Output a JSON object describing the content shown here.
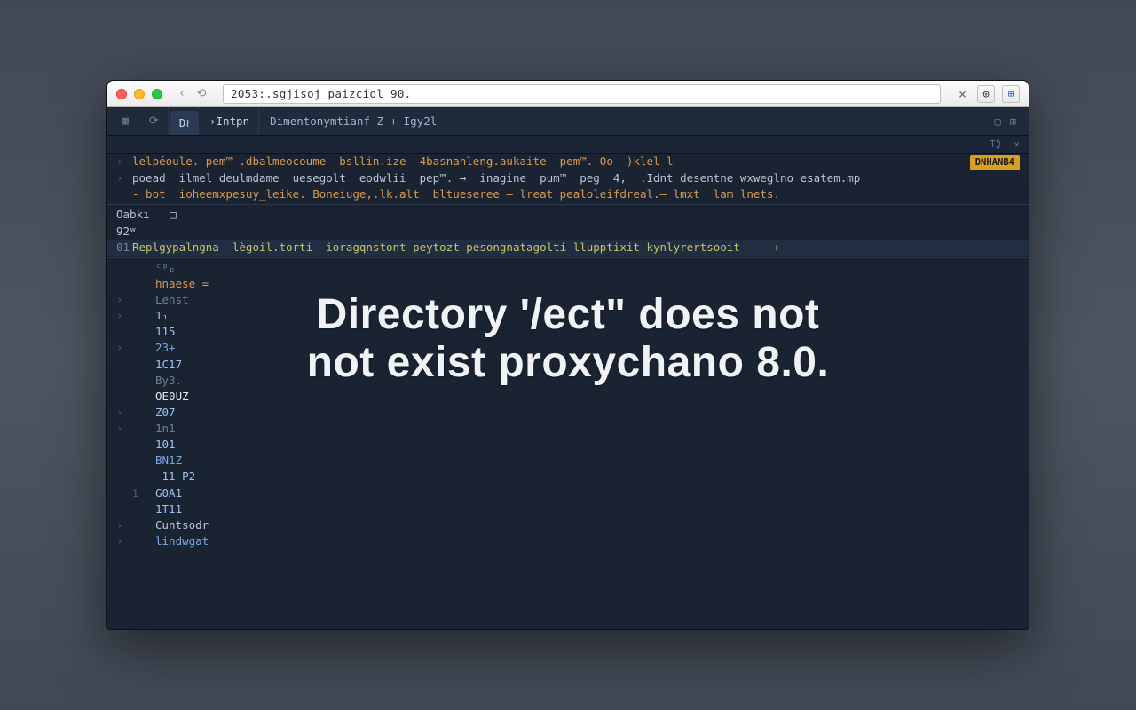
{
  "titlebar": {
    "address": "2053:.sgjisoj paizciol 90.",
    "close_label": "×"
  },
  "tabstrip": {
    "icon1": "▦",
    "icon2": "⟳",
    "tab_active": "D≀",
    "tab1": "Intpn",
    "tab2": "Dimentonymtianf  Z + Igy2l",
    "right1": "▢",
    "right2": "⊞"
  },
  "subtab": {
    "r1": "T⟫",
    "r2": "✕"
  },
  "badge": "DNHANB4",
  "rows": [
    {
      "g": "›",
      "txt": "lelpéoule. pem™ .dbalmeocoume  bsllin.ize  4basnanleng.aukaite  pem™. Oo  )klel l",
      "cls": "c-orange",
      "badge": true
    },
    {
      "g": "›",
      "txt": "poead  ilmel deulmdame  uesegolt  eodwlii  pep™. →  inagine  pum™  peg  4,  .Idnt desentne wxweglno esatem.mp",
      "cls": "c-lt"
    },
    {
      "g": " ",
      "txt": "- bot  ioheemxpesuy_leike. Boneiuge,.lk.alt  bltueseree — lreat pealoleifdreal.— lmxt  lam lnets.",
      "cls": "c-orange"
    }
  ],
  "hdr": {
    "l1": "Oabkı   □",
    "l2": "92ʷ"
  },
  "linehl": {
    "g": "01",
    "txt": "Replgypalngna -lègoil.torti  ioragqnstont peytozt pesongnatagolti llupptixit kynlyrertsooit     ›",
    "cls": "c-yellow"
  },
  "body": [
    {
      "g": " ",
      "ln": " ",
      "txt": "ᶜᵖₚ",
      "cls": "c-grey"
    },
    {
      "g": " ",
      "ln": " ",
      "txt": "hnaese =",
      "cls": "c-orange"
    },
    {
      "g": "›",
      "ln": " ",
      "txt": "Lenst",
      "cls": "c-grey"
    },
    {
      "g": "›",
      "ln": " ",
      "txt": "1₁",
      "cls": "c-ltblue"
    },
    {
      "g": " ",
      "ln": " ",
      "txt": "115",
      "cls": "c-ltblue"
    },
    {
      "g": "›",
      "ln": " ",
      "txt": "23+",
      "cls": "c-blue"
    },
    {
      "g": " ",
      "ln": " ",
      "txt": "1C17",
      "cls": "c-ltblue"
    },
    {
      "g": " ",
      "ln": " ",
      "txt": "By3.",
      "cls": "c-grey"
    },
    {
      "g": " ",
      "ln": " ",
      "txt": "OE0UZ",
      "cls": "c-white"
    },
    {
      "g": "›",
      "ln": " ",
      "txt": "Z07",
      "cls": "c-ltblue"
    },
    {
      "g": "›",
      "ln": " ",
      "txt": "1n1",
      "cls": "c-grey"
    },
    {
      "g": " ",
      "ln": " ",
      "txt": "101",
      "cls": "c-ltblue"
    },
    {
      "g": " ",
      "ln": " ",
      "txt": "BN1Z",
      "cls": "c-blue"
    },
    {
      "g": " ",
      "ln": " ",
      "txt": " 11 P2",
      "cls": "c-ltblue"
    },
    {
      "g": " ",
      "ln": "1",
      "txt": "G0A1",
      "cls": "c-ltblue"
    },
    {
      "g": " ",
      "ln": " ",
      "txt": "1T11",
      "cls": "c-ltblue"
    },
    {
      "g": "›",
      "ln": " ",
      "txt": "Cuntsodr",
      "cls": "c-lt"
    },
    {
      "g": "›",
      "ln": " ",
      "txt": "lindwgat",
      "cls": "c-blue"
    }
  ],
  "overlay": {
    "line1": "Directory '/ect\" does not",
    "line2": "not exist proxychano 8.0."
  }
}
